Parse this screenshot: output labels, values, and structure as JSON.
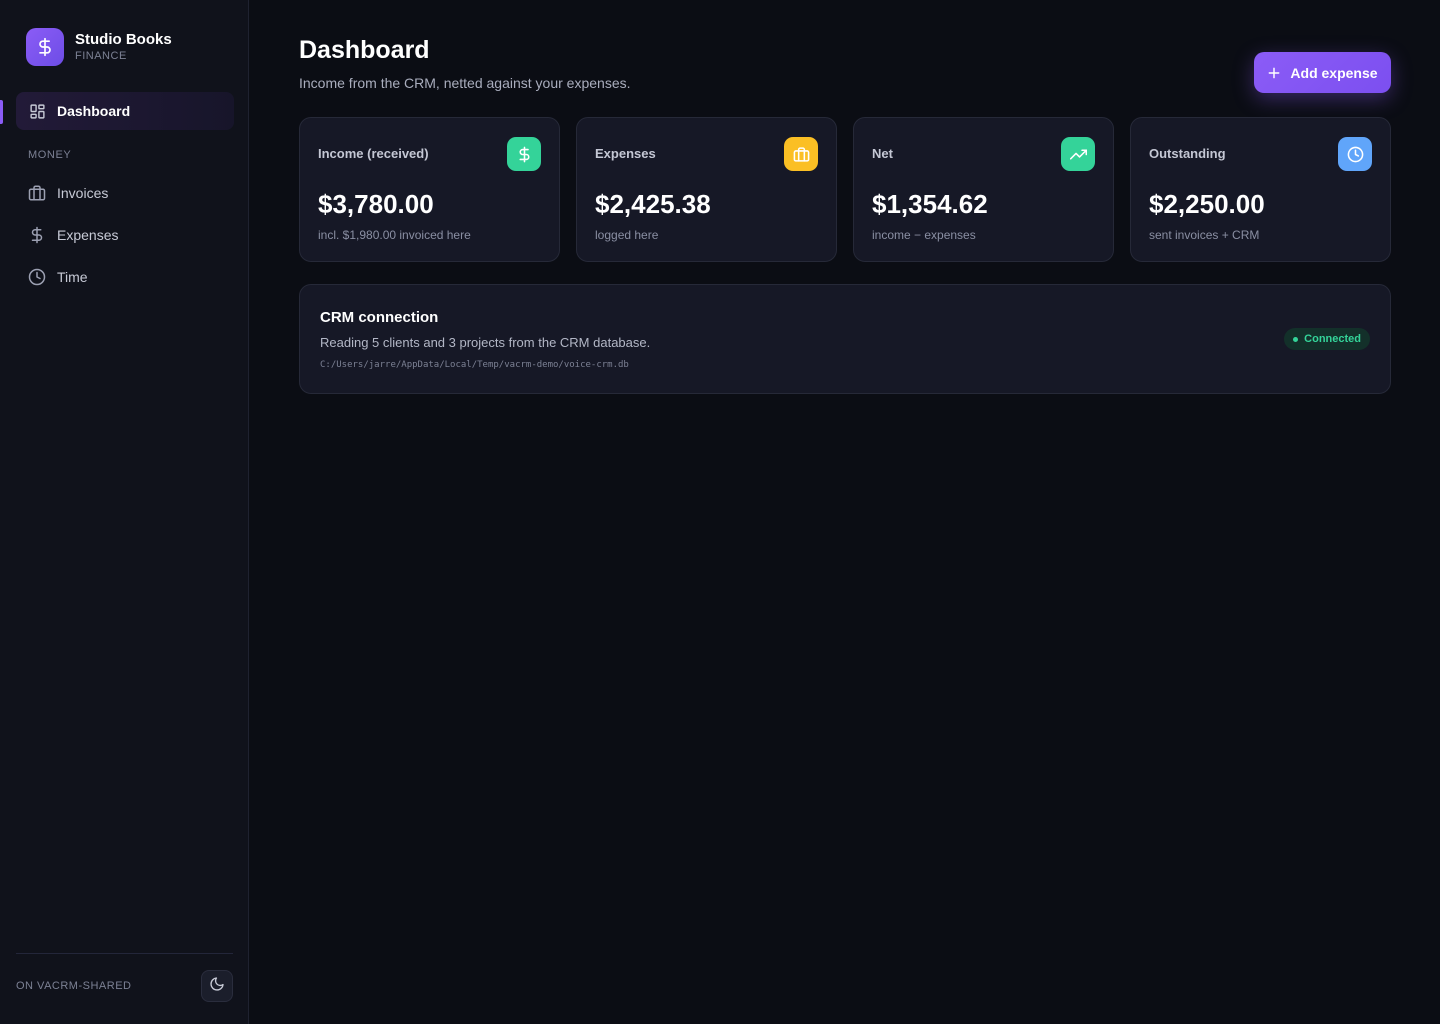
{
  "app": {
    "name": "Studio Books",
    "subtitle": "FINANCE",
    "accent": "#8b5cf6"
  },
  "sidebar": {
    "dashboard_label": "Dashboard",
    "section_label": "MONEY",
    "items": [
      {
        "label": "Invoices",
        "icon": "briefcase-icon"
      },
      {
        "label": "Expenses",
        "icon": "dollar-icon"
      },
      {
        "label": "Time",
        "icon": "clock-icon"
      }
    ],
    "footer_label": "ON VACRM-SHARED",
    "theme_toggle_icon": "moon-icon"
  },
  "header": {
    "title": "Dashboard",
    "subtitle": "Income from the CRM, netted against your expenses.",
    "add_button_label": "Add expense"
  },
  "cards": [
    {
      "label": "Income (received)",
      "value": "$3,780.00",
      "note": "incl. $1,980.00 invoiced here",
      "icon": "dollar-icon",
      "color": "#34d399"
    },
    {
      "label": "Expenses",
      "value": "$2,425.38",
      "note": "logged here",
      "icon": "briefcase-icon",
      "color": "#fbbf24"
    },
    {
      "label": "Net",
      "value": "$1,354.62",
      "note": "income − expenses",
      "icon": "trending-up-icon",
      "color": "#34d399"
    },
    {
      "label": "Outstanding",
      "value": "$2,250.00",
      "note": "sent invoices + CRM",
      "icon": "clock-icon",
      "color": "#60a5fa"
    }
  ],
  "crm": {
    "title": "CRM connection",
    "description": "Reading 5 clients and 3 projects from the CRM database.",
    "path": "C:/Users/jarre/AppData/Local/Temp/vacrm-demo/voice-crm.db",
    "status": "Connected",
    "status_color": "#34d399"
  }
}
